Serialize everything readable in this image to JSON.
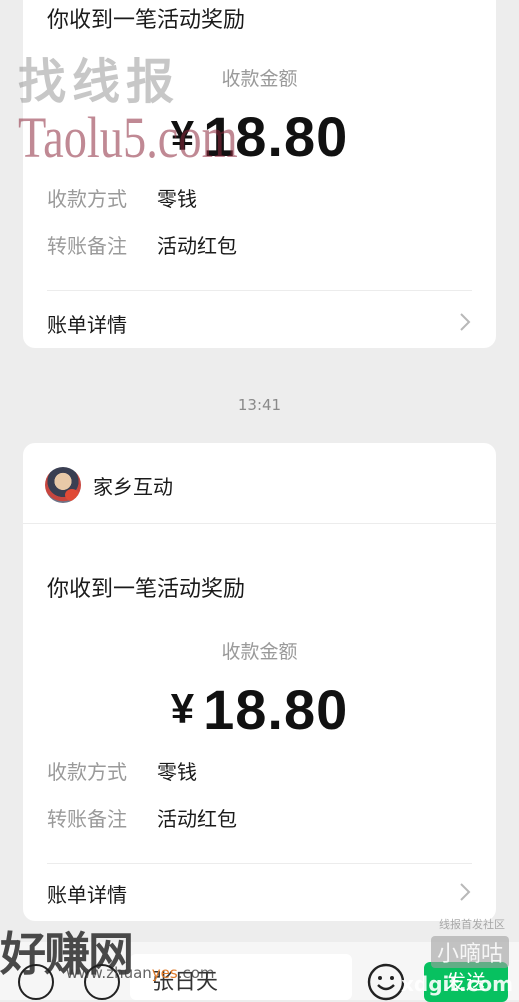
{
  "cards": [
    {
      "title": "你收到一笔活动奖励",
      "amount_label": "收款金额",
      "currency": "¥",
      "amount": "18.80",
      "rows": [
        {
          "key": "收款方式",
          "value": "零钱"
        },
        {
          "key": "转账备注",
          "value": "活动红包"
        }
      ],
      "bill_details": "账单详情"
    },
    {
      "sender": "家乡互动",
      "title": "你收到一笔活动奖励",
      "amount_label": "收款金额",
      "currency": "¥",
      "amount": "18.80",
      "rows": [
        {
          "key": "收款方式",
          "value": "零钱"
        },
        {
          "key": "转账备注",
          "value": "活动红包"
        }
      ],
      "bill_details": "账单详情"
    }
  ],
  "timestamp": "13:41",
  "input": {
    "text": "张日天",
    "send_label": "发送"
  },
  "watermarks": {
    "top_cn": "找线报",
    "top_en": "Taolu5.com",
    "bottom_cn": "好赚网",
    "bottom_url_a": "www.zhuan",
    "bottom_url_b": "yes",
    "bottom_url_c": ".com",
    "right_small": "线报首发社区",
    "right_cn": "小嘀咕",
    "right_url": "xdgit.com"
  },
  "colors": {
    "background": "#ededed",
    "card": "#ffffff",
    "send_button": "#07c160",
    "muted_text": "#9a9a9a"
  }
}
